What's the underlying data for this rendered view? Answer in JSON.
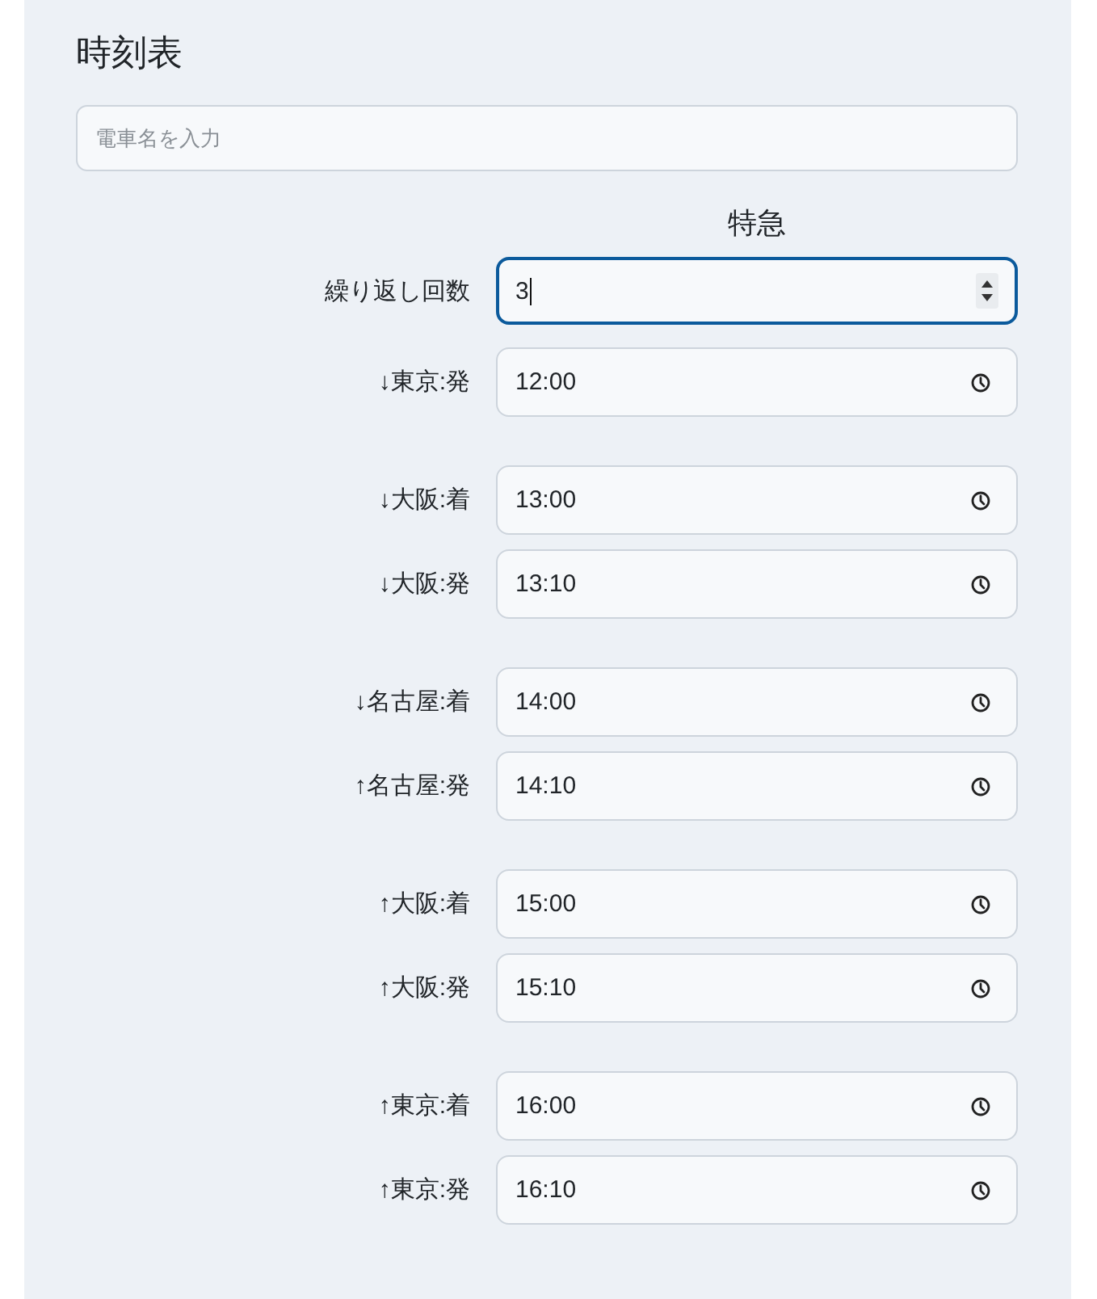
{
  "title": "時刻表",
  "train_name": {
    "placeholder": "電車名を入力"
  },
  "column_header": "特急",
  "repeat": {
    "label": "繰り返し回数",
    "value": "3",
    "focused": true
  },
  "groups": [
    {
      "rows": [
        {
          "label": "↓東京:発",
          "value": "12:00"
        }
      ]
    },
    {
      "rows": [
        {
          "label": "↓大阪:着",
          "value": "13:00"
        },
        {
          "label": "↓大阪:発",
          "value": "13:10"
        }
      ]
    },
    {
      "rows": [
        {
          "label": "↓名古屋:着",
          "value": "14:00"
        },
        {
          "label": "↑名古屋:発",
          "value": "14:10"
        }
      ]
    },
    {
      "rows": [
        {
          "label": "↑大阪:着",
          "value": "15:00"
        },
        {
          "label": "↑大阪:発",
          "value": "15:10"
        }
      ]
    },
    {
      "rows": [
        {
          "label": "↑東京:着",
          "value": "16:00"
        },
        {
          "label": "↑東京:発",
          "value": "16:10"
        }
      ]
    }
  ]
}
